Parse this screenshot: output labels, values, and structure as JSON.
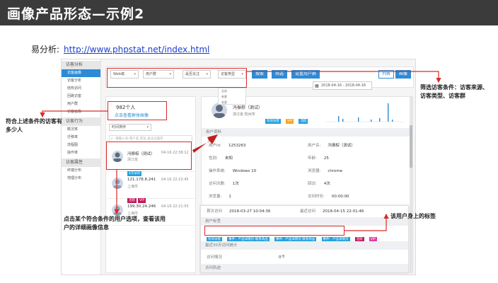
{
  "title": "画像产品形态—示例2",
  "analytics": {
    "label": "易分析:",
    "url": "http://www.phpstat.net/index.html"
  },
  "sidebar": {
    "groups": [
      {
        "label": "访客分析",
        "items": [
          "访客画像",
          "访客分析",
          "结构访问",
          "回跳访客",
          "用户群",
          "访客画像"
        ]
      },
      {
        "label": "访客行为",
        "items": [
          "概况率",
          "迁移率",
          "流程图",
          "操作率"
        ]
      },
      {
        "label": "访客属性",
        "items": [
          "终端分布",
          "地理分布"
        ]
      }
    ],
    "active_index": 0
  },
  "filter": {
    "dropdowns": [
      "Web端",
      "用户群",
      "是否关注",
      "访客类型"
    ],
    "search_label": "搜索",
    "reset_label": "筛选",
    "save_label": "设置用户群",
    "list_label": "列表",
    "portrait_label": "画像",
    "date_range": "2018-04-16 - 2018-04-16",
    "options": [
      "全部",
      "新客",
      "老客"
    ]
  },
  "list_panel": {
    "count": "982个人",
    "link": "点击查看群体画像",
    "sort": "时间排序",
    "search_placeholder": "请输入ID,用户名,浏览,关注与操作",
    "users": [
      {
        "name": "冯振棕（测试）",
        "time": "04-16 22:38:12",
        "location": "浙江省",
        "tags": [
          "4次访问"
        ]
      },
      {
        "name": "121.178.8.241",
        "time": "04-16 22:22:45",
        "location": "上海市",
        "tags": [
          "活跃",
          "VIP"
        ]
      },
      {
        "name": "199.30.24.246",
        "time": "04-16 22:21:55",
        "location": "上海市",
        "tags": []
      }
    ]
  },
  "detail_panel": {
    "name": "冯振棕（测试）",
    "location": "浙江省 杭州市",
    "tags": [
      "有效访客",
      "VIP",
      "活跃"
    ],
    "section_profile": "用户资料",
    "fields": [
      {
        "label": "用户Id:",
        "value": "1253263"
      },
      {
        "label": "用户名:",
        "value": "冯振棕（测试）"
      },
      {
        "label": "性别:",
        "value": "未知"
      },
      {
        "label": "年龄:",
        "value": "25"
      },
      {
        "label": "操作系统:",
        "value": "Windows 10"
      },
      {
        "label": "浏览器:",
        "value": "chrome"
      },
      {
        "label": "访问次数:",
        "value": "1次"
      },
      {
        "label": "回访:",
        "value": "4次"
      },
      {
        "label": "浏览量:",
        "value": "1"
      },
      {
        "label": "访问时长:",
        "value": "00:00:00"
      }
    ],
    "first_visit": {
      "label": "首次访问",
      "value": "2018-03-27 10:04:36"
    },
    "last_visit": {
      "label": "最近访问",
      "value": "2018-04-15 22:01:46"
    },
    "section_tags": "用户标签",
    "user_tags": [
      "有效访客",
      "事件：产品详情页-联系商品",
      "事件：产品详情页-联系商品",
      "事件：产品详情页",
      "活跃",
      "VIP"
    ],
    "section_recent": "最近30天访问统计",
    "section_trace": "访问轨迹",
    "recent_label": "访问情况",
    "recent_value": "0个"
  },
  "annotations": {
    "filter_note": "筛选访客条件：访客来源、访客类型、访客群",
    "count_note": "符合上述条件的访客有多少人",
    "click_note": "点击某个符合条件的用户选项，查看该用户的详细画像信息",
    "tag_note": "该用户身上的标签"
  },
  "colors": {
    "accent": "#2d8bd6",
    "annotation_red": "#d92b2b",
    "title_bg": "#3b3b3b",
    "tag_blue": "#1fa0e0",
    "tag_yellow": "#f5a623",
    "tag_magenta": "#c2185b"
  }
}
